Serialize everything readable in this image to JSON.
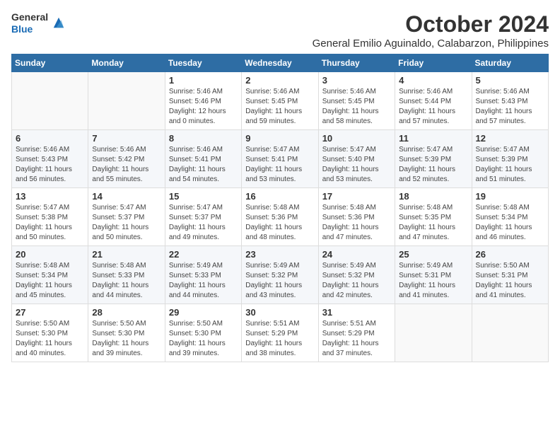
{
  "logo": {
    "general": "General",
    "blue": "Blue"
  },
  "header": {
    "month": "October 2024",
    "subtitle": "General Emilio Aguinaldo, Calabarzon, Philippines"
  },
  "weekdays": [
    "Sunday",
    "Monday",
    "Tuesday",
    "Wednesday",
    "Thursday",
    "Friday",
    "Saturday"
  ],
  "weeks": [
    [
      {
        "day": "",
        "sunrise": "",
        "sunset": "",
        "daylight": ""
      },
      {
        "day": "",
        "sunrise": "",
        "sunset": "",
        "daylight": ""
      },
      {
        "day": "1",
        "sunrise": "Sunrise: 5:46 AM",
        "sunset": "Sunset: 5:46 PM",
        "daylight": "Daylight: 12 hours and 0 minutes."
      },
      {
        "day": "2",
        "sunrise": "Sunrise: 5:46 AM",
        "sunset": "Sunset: 5:45 PM",
        "daylight": "Daylight: 11 hours and 59 minutes."
      },
      {
        "day": "3",
        "sunrise": "Sunrise: 5:46 AM",
        "sunset": "Sunset: 5:45 PM",
        "daylight": "Daylight: 11 hours and 58 minutes."
      },
      {
        "day": "4",
        "sunrise": "Sunrise: 5:46 AM",
        "sunset": "Sunset: 5:44 PM",
        "daylight": "Daylight: 11 hours and 57 minutes."
      },
      {
        "day": "5",
        "sunrise": "Sunrise: 5:46 AM",
        "sunset": "Sunset: 5:43 PM",
        "daylight": "Daylight: 11 hours and 57 minutes."
      }
    ],
    [
      {
        "day": "6",
        "sunrise": "Sunrise: 5:46 AM",
        "sunset": "Sunset: 5:43 PM",
        "daylight": "Daylight: 11 hours and 56 minutes."
      },
      {
        "day": "7",
        "sunrise": "Sunrise: 5:46 AM",
        "sunset": "Sunset: 5:42 PM",
        "daylight": "Daylight: 11 hours and 55 minutes."
      },
      {
        "day": "8",
        "sunrise": "Sunrise: 5:46 AM",
        "sunset": "Sunset: 5:41 PM",
        "daylight": "Daylight: 11 hours and 54 minutes."
      },
      {
        "day": "9",
        "sunrise": "Sunrise: 5:47 AM",
        "sunset": "Sunset: 5:41 PM",
        "daylight": "Daylight: 11 hours and 53 minutes."
      },
      {
        "day": "10",
        "sunrise": "Sunrise: 5:47 AM",
        "sunset": "Sunset: 5:40 PM",
        "daylight": "Daylight: 11 hours and 53 minutes."
      },
      {
        "day": "11",
        "sunrise": "Sunrise: 5:47 AM",
        "sunset": "Sunset: 5:39 PM",
        "daylight": "Daylight: 11 hours and 52 minutes."
      },
      {
        "day": "12",
        "sunrise": "Sunrise: 5:47 AM",
        "sunset": "Sunset: 5:39 PM",
        "daylight": "Daylight: 11 hours and 51 minutes."
      }
    ],
    [
      {
        "day": "13",
        "sunrise": "Sunrise: 5:47 AM",
        "sunset": "Sunset: 5:38 PM",
        "daylight": "Daylight: 11 hours and 50 minutes."
      },
      {
        "day": "14",
        "sunrise": "Sunrise: 5:47 AM",
        "sunset": "Sunset: 5:37 PM",
        "daylight": "Daylight: 11 hours and 50 minutes."
      },
      {
        "day": "15",
        "sunrise": "Sunrise: 5:47 AM",
        "sunset": "Sunset: 5:37 PM",
        "daylight": "Daylight: 11 hours and 49 minutes."
      },
      {
        "day": "16",
        "sunrise": "Sunrise: 5:48 AM",
        "sunset": "Sunset: 5:36 PM",
        "daylight": "Daylight: 11 hours and 48 minutes."
      },
      {
        "day": "17",
        "sunrise": "Sunrise: 5:48 AM",
        "sunset": "Sunset: 5:36 PM",
        "daylight": "Daylight: 11 hours and 47 minutes."
      },
      {
        "day": "18",
        "sunrise": "Sunrise: 5:48 AM",
        "sunset": "Sunset: 5:35 PM",
        "daylight": "Daylight: 11 hours and 47 minutes."
      },
      {
        "day": "19",
        "sunrise": "Sunrise: 5:48 AM",
        "sunset": "Sunset: 5:34 PM",
        "daylight": "Daylight: 11 hours and 46 minutes."
      }
    ],
    [
      {
        "day": "20",
        "sunrise": "Sunrise: 5:48 AM",
        "sunset": "Sunset: 5:34 PM",
        "daylight": "Daylight: 11 hours and 45 minutes."
      },
      {
        "day": "21",
        "sunrise": "Sunrise: 5:48 AM",
        "sunset": "Sunset: 5:33 PM",
        "daylight": "Daylight: 11 hours and 44 minutes."
      },
      {
        "day": "22",
        "sunrise": "Sunrise: 5:49 AM",
        "sunset": "Sunset: 5:33 PM",
        "daylight": "Daylight: 11 hours and 44 minutes."
      },
      {
        "day": "23",
        "sunrise": "Sunrise: 5:49 AM",
        "sunset": "Sunset: 5:32 PM",
        "daylight": "Daylight: 11 hours and 43 minutes."
      },
      {
        "day": "24",
        "sunrise": "Sunrise: 5:49 AM",
        "sunset": "Sunset: 5:32 PM",
        "daylight": "Daylight: 11 hours and 42 minutes."
      },
      {
        "day": "25",
        "sunrise": "Sunrise: 5:49 AM",
        "sunset": "Sunset: 5:31 PM",
        "daylight": "Daylight: 11 hours and 41 minutes."
      },
      {
        "day": "26",
        "sunrise": "Sunrise: 5:50 AM",
        "sunset": "Sunset: 5:31 PM",
        "daylight": "Daylight: 11 hours and 41 minutes."
      }
    ],
    [
      {
        "day": "27",
        "sunrise": "Sunrise: 5:50 AM",
        "sunset": "Sunset: 5:30 PM",
        "daylight": "Daylight: 11 hours and 40 minutes."
      },
      {
        "day": "28",
        "sunrise": "Sunrise: 5:50 AM",
        "sunset": "Sunset: 5:30 PM",
        "daylight": "Daylight: 11 hours and 39 minutes."
      },
      {
        "day": "29",
        "sunrise": "Sunrise: 5:50 AM",
        "sunset": "Sunset: 5:30 PM",
        "daylight": "Daylight: 11 hours and 39 minutes."
      },
      {
        "day": "30",
        "sunrise": "Sunrise: 5:51 AM",
        "sunset": "Sunset: 5:29 PM",
        "daylight": "Daylight: 11 hours and 38 minutes."
      },
      {
        "day": "31",
        "sunrise": "Sunrise: 5:51 AM",
        "sunset": "Sunset: 5:29 PM",
        "daylight": "Daylight: 11 hours and 37 minutes."
      },
      {
        "day": "",
        "sunrise": "",
        "sunset": "",
        "daylight": ""
      },
      {
        "day": "",
        "sunrise": "",
        "sunset": "",
        "daylight": ""
      }
    ]
  ]
}
